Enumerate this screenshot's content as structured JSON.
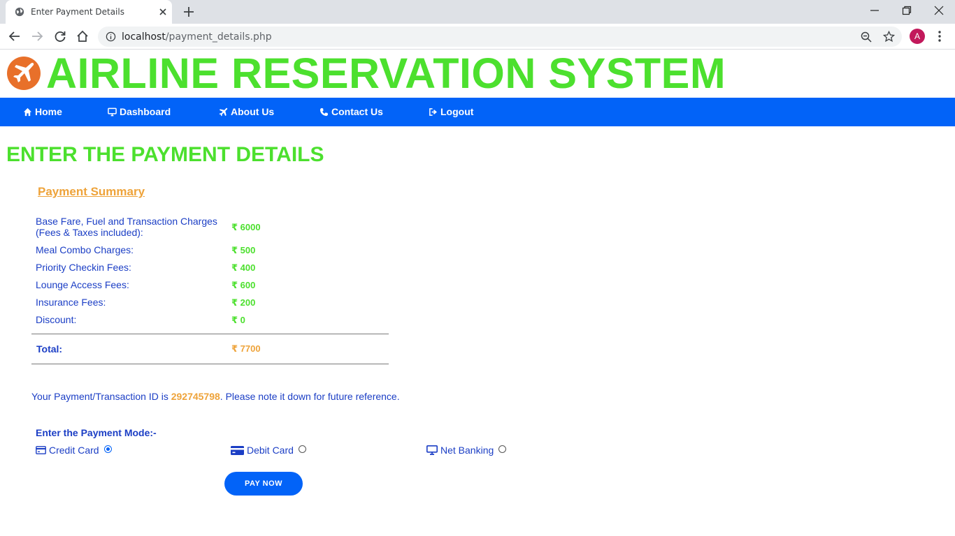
{
  "browser": {
    "tab_title": "Enter Payment Details",
    "url_host": "localhost",
    "url_path": "/payment_details.php",
    "avatar_letter": "A"
  },
  "site": {
    "title": "AIRLINE RESERVATION SYSTEM",
    "brand_color": "#4ce02e",
    "nav_color": "#0263f8"
  },
  "nav": {
    "items": [
      {
        "label": "Home",
        "icon": "home-icon"
      },
      {
        "label": "Dashboard",
        "icon": "desktop-icon"
      },
      {
        "label": "About Us",
        "icon": "plane-icon"
      },
      {
        "label": "Contact Us",
        "icon": "phone-icon"
      },
      {
        "label": "Logout",
        "icon": "logout-icon"
      }
    ]
  },
  "main": {
    "heading": "ENTER THE PAYMENT DETAILS",
    "summary_heading": "Payment Summary",
    "rows": [
      {
        "label_line1": "Base Fare, Fuel and Transaction Charges",
        "label_line2": "(Fees & Taxes included):",
        "amount": "₹ 6000"
      },
      {
        "label": "Meal Combo Charges:",
        "amount": "₹ 500"
      },
      {
        "label": "Priority Checkin Fees:",
        "amount": "₹ 400"
      },
      {
        "label": "Lounge Access Fees:",
        "amount": "₹ 600"
      },
      {
        "label": "Insurance Fees:",
        "amount": "₹ 200"
      },
      {
        "label": "Discount:",
        "amount": "₹ 0"
      }
    ],
    "total_label": "Total:",
    "total_amount": "₹ 7700",
    "txn_prefix": "Your Payment/Transaction ID is ",
    "txn_id": "292745798",
    "txn_suffix": ". Please note it down for future reference.",
    "mode_label": "Enter the Payment Mode:-",
    "modes": [
      {
        "label": "Credit Card",
        "icon": "credit-card-icon",
        "selected": true
      },
      {
        "label": "Debit Card",
        "icon": "debit-card-icon",
        "selected": false
      },
      {
        "label": "Net Banking",
        "icon": "desktop-icon",
        "selected": false
      }
    ],
    "pay_button": "PAY NOW"
  }
}
